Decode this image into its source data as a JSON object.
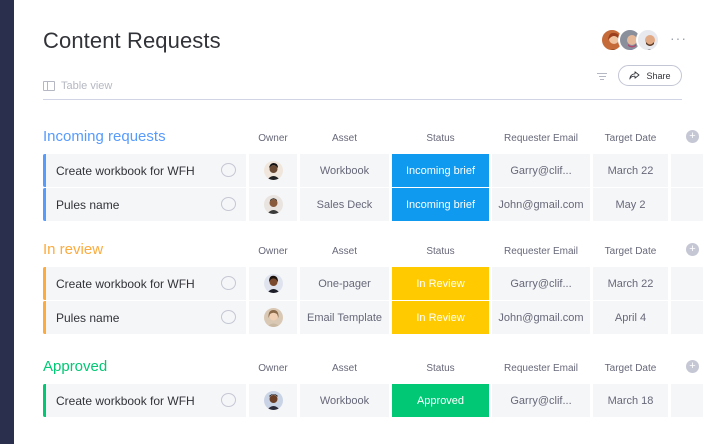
{
  "page": {
    "title": "Content Requests",
    "view_label": "Table view",
    "share_label": "Share",
    "more_label": "···"
  },
  "colors": {
    "sidebar": "#292f4c",
    "incoming": "#579bfc",
    "review": "#fdab3d",
    "approved": "#00c875",
    "status_blue": "#0f9af0",
    "status_yellow": "#ffcb00",
    "status_green": "#00c875"
  },
  "columns": {
    "owner": "Owner",
    "asset": "Asset",
    "status": "Status",
    "email": "Requester Email",
    "date": "Target Date",
    "add": "+"
  },
  "groups": [
    {
      "title": "Incoming requests",
      "rows": [
        {
          "name": "Create workbook for WFH",
          "asset": "Workbook",
          "status": "Incoming brief",
          "email": "Garry@clif...",
          "date": "March 22"
        },
        {
          "name": "Pules name",
          "asset": "Sales Deck",
          "status": "Incoming brief",
          "email": "John@gmail.com",
          "date": "May 2"
        }
      ]
    },
    {
      "title": "In review",
      "rows": [
        {
          "name": "Create workbook for WFH",
          "asset": "One-pager",
          "status": "In Review",
          "email": "Garry@clif...",
          "date": "March 22"
        },
        {
          "name": "Pules name",
          "asset": "Email Template",
          "status": "In Review",
          "email": "John@gmail.com",
          "date": "April 4"
        }
      ]
    },
    {
      "title": "Approved",
      "rows": [
        {
          "name": "Create workbook for WFH",
          "asset": "Workbook",
          "status": "Approved",
          "email": "Garry@clif...",
          "date": "March 18"
        }
      ]
    }
  ]
}
